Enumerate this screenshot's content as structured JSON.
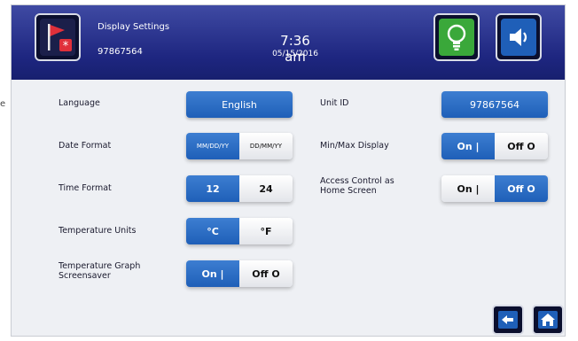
{
  "header": {
    "title": "Display Settings",
    "unit_id": "97867564",
    "time": "7:36 am",
    "date": "05/15/2016",
    "colors": {
      "bar": "#1e2680",
      "accent_blue": "#1f5fb8",
      "alarm_red": "#e0303a",
      "bulb_green": "#3aa83a"
    }
  },
  "stray_char": "e",
  "settings": {
    "language": {
      "label": "Language",
      "value": "English"
    },
    "date_format": {
      "label": "Date Format",
      "options": [
        "MM/DD/YY",
        "DD/MM/YY"
      ],
      "selected": "MM/DD/YY"
    },
    "time_format": {
      "label": "Time Format",
      "options": [
        "12",
        "24"
      ],
      "selected": "12"
    },
    "temperature_units": {
      "label": "Temperature Units",
      "options": [
        "°C",
        "°F"
      ],
      "selected": "°C"
    },
    "graph_screensaver": {
      "label_line1": "Temperature Graph",
      "label_line2": "Screensaver",
      "options": [
        "On  |",
        "Off  O"
      ],
      "selected": "On  |"
    },
    "unit_id": {
      "label": "Unit ID",
      "value": "97867564"
    },
    "min_max_display": {
      "label": "Min/Max Display",
      "options": [
        "On  |",
        "Off  O"
      ],
      "selected": "On  |"
    },
    "access_control": {
      "label_line1": "Access Control as",
      "label_line2": "Home Screen",
      "options": [
        "On  |",
        "Off  O"
      ],
      "selected": "Off  O"
    }
  },
  "icons": {
    "alarm": "alarm-flag-icon",
    "light": "lightbulb-icon",
    "sound": "speaker-icon",
    "back": "back-arrow-icon",
    "home": "home-icon"
  }
}
